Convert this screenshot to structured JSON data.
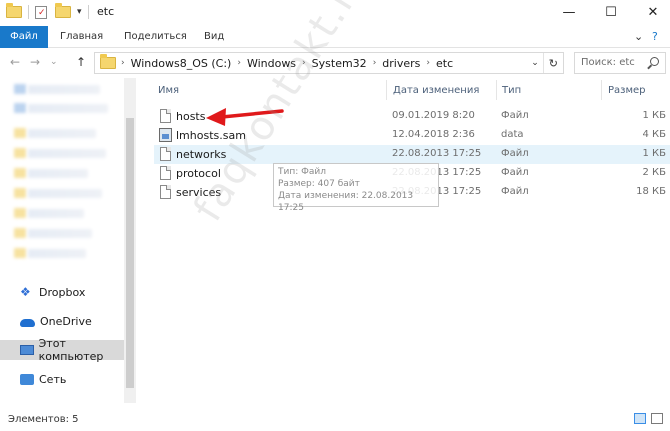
{
  "window": {
    "title": "etc",
    "minimize": "—",
    "maximize": "☐",
    "close": "✕"
  },
  "ribbon": {
    "tabs": [
      "Файл",
      "Главная",
      "Поделиться",
      "Вид"
    ],
    "collapse": "⌄",
    "help": "?"
  },
  "nav": {
    "back": "←",
    "forward": "→",
    "up": "↑",
    "recent": "⌄",
    "refresh": "↻",
    "history": "⌄"
  },
  "breadcrumb": [
    "Windows8_OS (C:)",
    "Windows",
    "System32",
    "drivers",
    "etc"
  ],
  "search": {
    "placeholder": "Поиск: etc"
  },
  "sidebar": {
    "items": [
      {
        "label": "Dropbox",
        "icon": "dropbox-icon"
      },
      {
        "label": "OneDrive",
        "icon": "onedrive-icon"
      },
      {
        "label": "Этот компьютер",
        "icon": "this-pc-icon"
      },
      {
        "label": "Сеть",
        "icon": "network-icon"
      }
    ]
  },
  "columns": {
    "name": "Имя",
    "date": "Дата изменения",
    "type": "Тип",
    "size": "Размер"
  },
  "files": [
    {
      "name": "hosts",
      "date": "09.01.2019 8:20",
      "type": "Файл",
      "size": "1 КБ"
    },
    {
      "name": "lmhosts.sam",
      "date": "12.04.2018 2:36",
      "type": "data",
      "size": "4 КБ"
    },
    {
      "name": "networks",
      "date": "22.08.2013 17:25",
      "type": "Файл",
      "size": "1 КБ"
    },
    {
      "name": "protocol",
      "date": "22.08.2013 17:25",
      "type": "Файл",
      "size": "2 КБ"
    },
    {
      "name": "services",
      "date": "22.08.2013 17:25",
      "type": "Файл",
      "size": "18 КБ"
    }
  ],
  "tooltip": {
    "line1": "Тип: Файл",
    "line2": "Размер: 407 байт",
    "line3": "Дата изменения: 22.08.2013 17:25"
  },
  "status": {
    "items_count": "Элементов: 5"
  },
  "watermark": "faqkontakt.ru",
  "colors": {
    "accent": "#1979ca",
    "arrow": "#e0191b",
    "hover_row": "#e5f3fb"
  }
}
